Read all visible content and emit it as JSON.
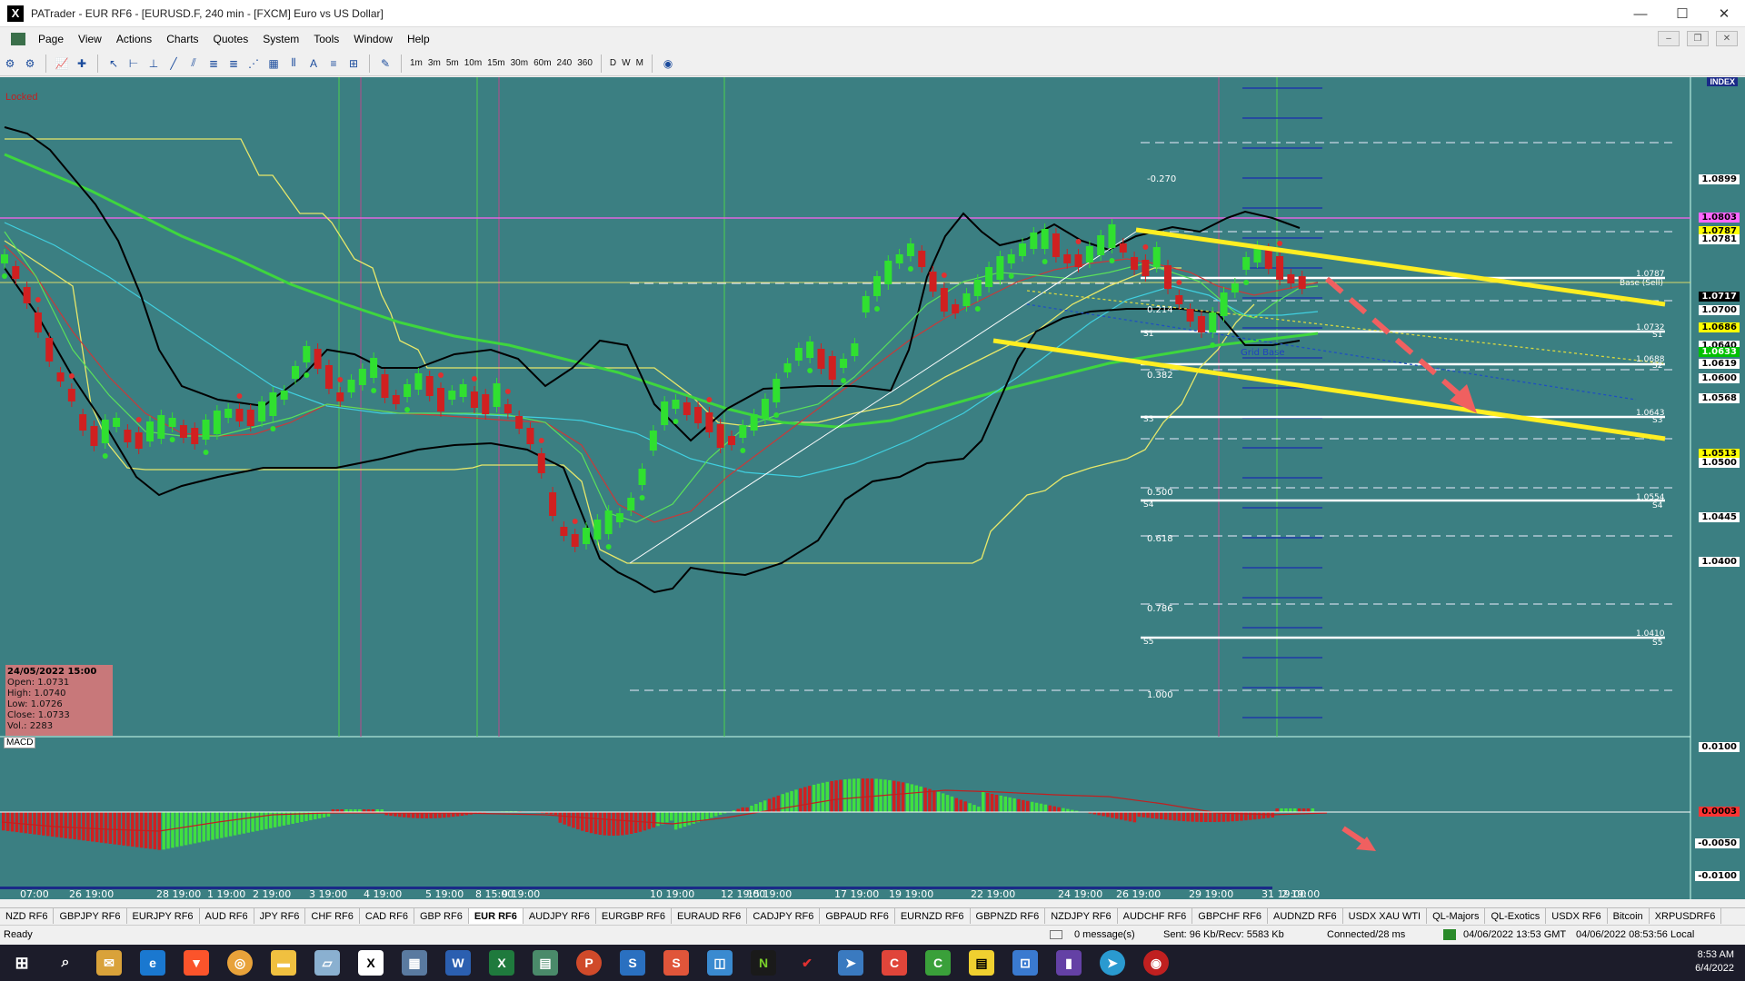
{
  "window": {
    "title": "PATrader - EUR RF6 - [EURUSD.F, 240 min - [FXCM] Euro vs US Dollar]",
    "logo": "X",
    "buttons": [
      "—",
      "☐",
      "✕"
    ]
  },
  "menu": [
    "Page",
    "View",
    "Actions",
    "Charts",
    "Quotes",
    "System",
    "Tools",
    "Window",
    "Help"
  ],
  "timeframes": [
    "1m",
    "3m",
    "5m",
    "10m",
    "15m",
    "30m",
    "60m",
    "240",
    "360",
    "D",
    "W",
    "M"
  ],
  "chart": {
    "locked": "Locked",
    "index_label": "INDEX",
    "macd_label": "MACD",
    "ohlc": {
      "date": "24/05/2022 15:00",
      "open": "Open: 1.0731",
      "high": "High: 1.0740",
      "low": "Low: 1.0726",
      "close": "Close: 1.0733",
      "vol": "Vol.: 2283"
    },
    "grid_base": "Grid Base",
    "base_sell": "Base (Sell)",
    "fib_levels": [
      "-0.270",
      "0.214",
      "0.382",
      "0.500",
      "0.618",
      "0.786",
      "1.000"
    ],
    "pivot_labels": [
      "S1",
      "S2",
      "S3",
      "S4",
      "S5"
    ],
    "price_labels": [
      {
        "text": "1.0899",
        "bg": "#ffffff",
        "fg": "#000000"
      },
      {
        "text": "1.0803",
        "bg": "#ff66ff",
        "fg": "#000000"
      },
      {
        "text": "1.0787",
        "bg": "#ffff00",
        "fg": "#000000"
      },
      {
        "text": "1.0781",
        "bg": "#ffffff",
        "fg": "#000000"
      },
      {
        "text": "1.0717",
        "bg": "#000000",
        "fg": "#ffffff"
      },
      {
        "text": "1.0700",
        "bg": "#ffffff",
        "fg": "#000000"
      },
      {
        "text": "1.0686",
        "bg": "#ffff00",
        "fg": "#000000"
      },
      {
        "text": "1.0640",
        "bg": "#ffffff",
        "fg": "#000000"
      },
      {
        "text": "1.0633",
        "bg": "#00c000",
        "fg": "#ffffff"
      },
      {
        "text": "1.0619",
        "bg": "#ffffff",
        "fg": "#000000"
      },
      {
        "text": "1.0600",
        "bg": "#ffffff",
        "fg": "#000000"
      },
      {
        "text": "1.0568",
        "bg": "#ffffff",
        "fg": "#000000"
      },
      {
        "text": "1.0513",
        "bg": "#ffff00",
        "fg": "#000000"
      },
      {
        "text": "1.0500",
        "bg": "#ffffff",
        "fg": "#000000"
      },
      {
        "text": "1.0445",
        "bg": "#ffffff",
        "fg": "#000000"
      },
      {
        "text": "1.0400",
        "bg": "#ffffff",
        "fg": "#000000"
      }
    ],
    "level_values": [
      "1.0787",
      "1.0732",
      "1.0688",
      "1.0643",
      "1.0554",
      "1.0410"
    ],
    "macd_labels": [
      {
        "text": "0.0100",
        "bg": "#ffffff",
        "fg": "#000000"
      },
      {
        "text": "0.0003",
        "bg": "#ff3333",
        "fg": "#000000"
      },
      {
        "text": "-0.0050",
        "bg": "#ffffff",
        "fg": "#000000"
      },
      {
        "text": "-0.0100",
        "bg": "#ffffff",
        "fg": "#000000"
      }
    ],
    "dates": [
      "07:00",
      "26 19:00",
      "28 19:00",
      "1 19:00",
      "2 19:00",
      "3 19:00",
      "4 19:00",
      "5 19:00",
      "8 15:00",
      "9 19:00",
      "10 19:00",
      "12 19:00",
      "15 19:00",
      "17 19:00",
      "19 19:00",
      "22 19:00",
      "24 19:00",
      "26 19:00",
      "29 19:00",
      "31 19:00",
      "2 19:00"
    ]
  },
  "tabs": [
    "NZD RF6",
    "GBPJPY RF6",
    "EURJPY RF6",
    "AUD RF6",
    "JPY RF6",
    "CHF RF6",
    "CAD RF6",
    "GBP RF6",
    "EUR RF6",
    "AUDJPY RF6",
    "EURGBP RF6",
    "EURAUD RF6",
    "CADJPY RF6",
    "GBPAUD RF6",
    "EURNZD RF6",
    "GBPNZD RF6",
    "NZDJPY RF6",
    "AUDCHF RF6",
    "GBPCHF RF6",
    "AUDNZD RF6",
    "USDX XAU WTI",
    "QL-Majors",
    "QL-Exotics",
    "USDX RF6",
    "Bitcoin",
    "XRPUSDRF6"
  ],
  "active_tab": "EUR RF6",
  "status": {
    "ready": "Ready",
    "messages": "0 message(s)",
    "traffic": "Sent: 96 Kb/Recv: 5583 Kb",
    "connection": "Connected/28 ms",
    "gmt_time": "04/06/2022 13:53 GMT",
    "local_time": "04/06/2022 08:53:56 Local"
  },
  "taskbar": {
    "time": "8:53 AM",
    "date": "6/4/2022"
  }
}
